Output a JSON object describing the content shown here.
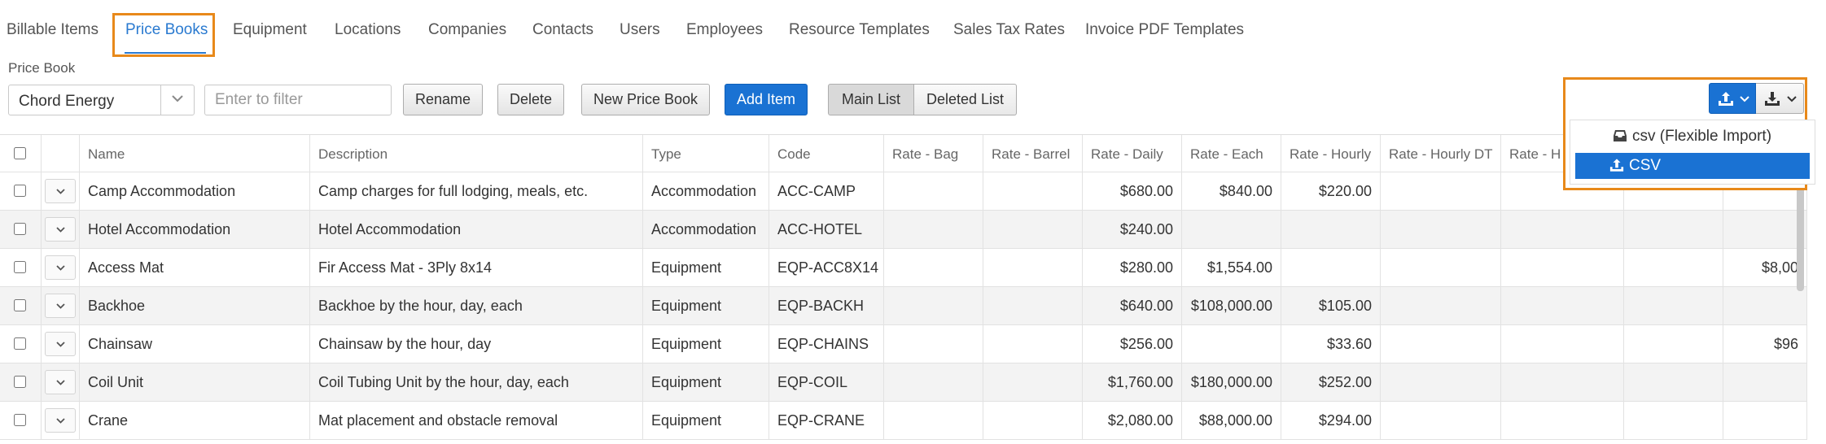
{
  "tabs": [
    {
      "label": "Billable Items"
    },
    {
      "label": "Price Books"
    },
    {
      "label": "Equipment"
    },
    {
      "label": "Locations"
    },
    {
      "label": "Companies"
    },
    {
      "label": "Contacts"
    },
    {
      "label": "Users"
    },
    {
      "label": "Employees"
    },
    {
      "label": "Resource Templates"
    },
    {
      "label": "Sales Tax Rates"
    },
    {
      "label": "Invoice PDF Templates"
    }
  ],
  "active_tab": "Price Books",
  "toolbar": {
    "price_book_label": "Price Book",
    "selected_price_book": "Chord Energy",
    "filter_placeholder": "Enter to filter",
    "rename": "Rename",
    "delete": "Delete",
    "new_price_book": "New Price Book",
    "add_item": "Add Item",
    "main_list": "Main List",
    "deleted_list": "Deleted List"
  },
  "columns": [
    "Name",
    "Description",
    "Type",
    "Code",
    "Rate - Bag",
    "Rate - Barrel",
    "Rate - Daily",
    "Rate - Each",
    "Rate - Hourly",
    "Rate - Hourly DT",
    "Rate - H",
    "",
    ""
  ],
  "rows": [
    {
      "name": "Camp Accommodation",
      "description": "Camp charges for full lodging, meals, etc.",
      "type": "Accommodation",
      "code": "ACC-CAMP",
      "bag": "",
      "barrel": "",
      "daily": "$680.00",
      "each": "$840.00",
      "hourly": "$220.00",
      "hourly_dt": "",
      "h": "",
      "c11": "",
      "c12": ""
    },
    {
      "name": "Hotel Accommodation",
      "description": "Hotel Accommodation",
      "type": "Accommodation",
      "code": "ACC-HOTEL",
      "bag": "",
      "barrel": "",
      "daily": "$240.00",
      "each": "",
      "hourly": "",
      "hourly_dt": "",
      "h": "",
      "c11": "",
      "c12": ""
    },
    {
      "name": "Access Mat",
      "description": "Fir Access Mat - 3Ply 8x14",
      "type": "Equipment",
      "code": "EQP-ACC8X14",
      "bag": "",
      "barrel": "",
      "daily": "$280.00",
      "each": "$1,554.00",
      "hourly": "",
      "hourly_dt": "",
      "h": "",
      "c11": "",
      "c12": "$8,00"
    },
    {
      "name": "Backhoe",
      "description": "Backhoe by the hour, day, each",
      "type": "Equipment",
      "code": "EQP-BACKH",
      "bag": "",
      "barrel": "",
      "daily": "$640.00",
      "each": "$108,000.00",
      "hourly": "$105.00",
      "hourly_dt": "",
      "h": "",
      "c11": "",
      "c12": ""
    },
    {
      "name": "Chainsaw",
      "description": "Chainsaw by the hour, day",
      "type": "Equipment",
      "code": "EQP-CHAINS",
      "bag": "",
      "barrel": "",
      "daily": "$256.00",
      "each": "",
      "hourly": "$33.60",
      "hourly_dt": "",
      "h": "",
      "c11": "",
      "c12": "$96"
    },
    {
      "name": "Coil Unit",
      "description": "Coil Tubing Unit by the hour, day, each",
      "type": "Equipment",
      "code": "EQP-COIL",
      "bag": "",
      "barrel": "",
      "daily": "$1,760.00",
      "each": "$180,000.00",
      "hourly": "$252.00",
      "hourly_dt": "",
      "h": "",
      "c11": "",
      "c12": ""
    },
    {
      "name": "Crane",
      "description": "Mat placement and obstacle removal",
      "type": "Equipment",
      "code": "EQP-CRANE",
      "bag": "",
      "barrel": "",
      "daily": "$2,080.00",
      "each": "$88,000.00",
      "hourly": "$294.00",
      "hourly_dt": "",
      "h": "",
      "c11": "",
      "c12": ""
    }
  ],
  "export_menu": {
    "items": [
      {
        "label": "csv (Flexible Import)",
        "icon": "inbox-icon"
      },
      {
        "label": "CSV",
        "icon": "upload-icon"
      }
    ]
  },
  "colors": {
    "accent": "#1a72d3",
    "highlight": "#e8891a",
    "tab_active": "#2a7ad0"
  }
}
